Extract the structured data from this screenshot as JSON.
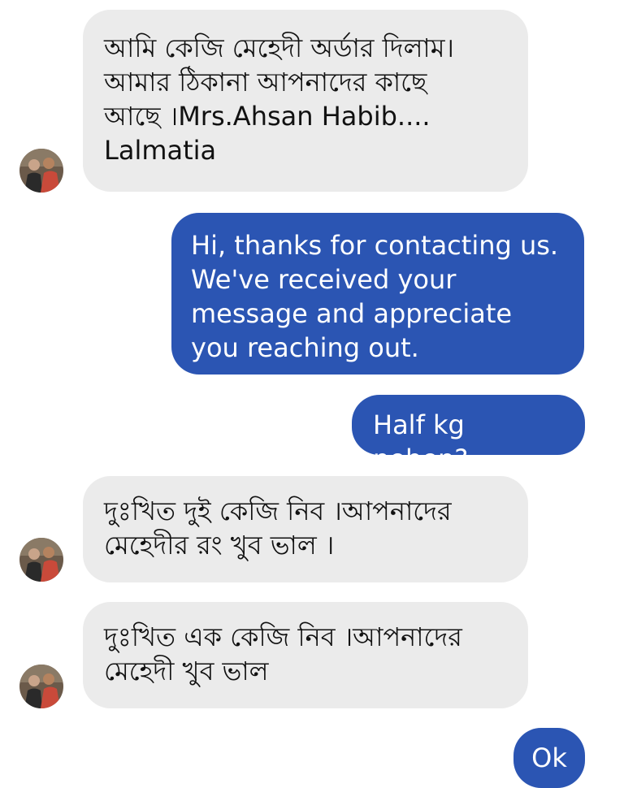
{
  "colors": {
    "incoming_bubble": "#ebebeb",
    "outgoing_bubble": "#2b55b3",
    "incoming_text": "#111111",
    "outgoing_text": "#ffffff",
    "background": "#ffffff"
  },
  "messages": [
    {
      "direction": "incoming",
      "text": "আমি কেজি মেহেদী অর্ডার দিলাম।\nআমার ঠিকানা আপনাদের কাছে\nআছে ।Mrs.Ahsan Habib....\nLalmatia"
    },
    {
      "direction": "outgoing",
      "text": "Hi, thanks for contacting us.\nWe've received your\nmessage and appreciate\nyou reaching out."
    },
    {
      "direction": "outgoing",
      "text": "Half kg neben?"
    },
    {
      "direction": "incoming",
      "text": "দুঃখিত দুই কেজি নিব ।আপনাদের\nমেহেদীর রং খুব ভাল ।"
    },
    {
      "direction": "incoming",
      "text": "দুঃখিত এক কেজি নিব ।আপনাদের\nমেহেদী খুব ভাল"
    },
    {
      "direction": "outgoing",
      "text": "Ok"
    }
  ],
  "avatar_icon": "contact-photo-avatar-icon"
}
